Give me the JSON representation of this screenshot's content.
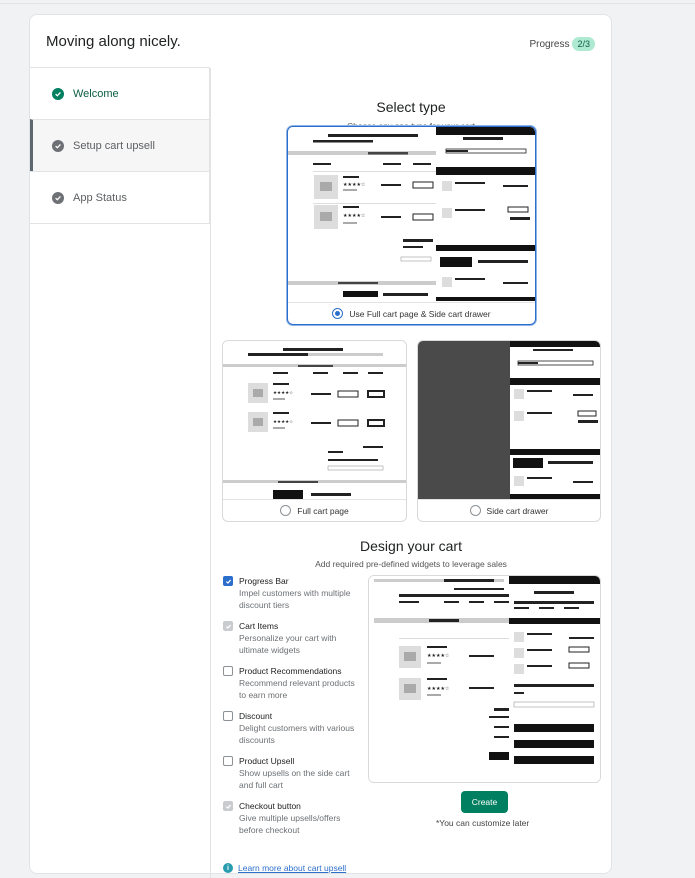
{
  "header": {
    "title": "Moving along nicely.",
    "progress_label": "Progress",
    "progress_value": "2/3"
  },
  "sidebar": {
    "items": [
      {
        "label": "Welcome",
        "status": "done"
      },
      {
        "label": "Setup cart upsell",
        "status": "todo"
      },
      {
        "label": "App Status",
        "status": "todo"
      }
    ]
  },
  "select_type": {
    "title": "Select type",
    "subtitle": "Choose any one type for your cart",
    "options": [
      {
        "label": "Use Full cart page & Side cart drawer",
        "selected": true
      },
      {
        "label": "Full cart page",
        "selected": false
      },
      {
        "label": "Side cart drawer",
        "selected": false
      }
    ]
  },
  "design": {
    "title": "Design your cart",
    "subtitle": "Add required pre-defined widgets to leverage sales",
    "widgets": [
      {
        "title": "Progress Bar",
        "desc": "Impel customers with multiple discount tiers",
        "state": "checked"
      },
      {
        "title": "Cart Items",
        "desc": "Personalize your cart with ultimate widgets",
        "state": "disabled"
      },
      {
        "title": "Product Recommendations",
        "desc": "Recommend relevant products to earn more",
        "state": "unchecked"
      },
      {
        "title": "Discount",
        "desc": "Delight customers with various discounts",
        "state": "unchecked"
      },
      {
        "title": "Product Upsell",
        "desc": "Show upsells on the side cart and full cart",
        "state": "unchecked"
      },
      {
        "title": "Checkout button",
        "desc": "Give multiple upsells/offers before checkout",
        "state": "disabled"
      }
    ],
    "create_label": "Create",
    "note": "*You can customize later"
  },
  "footer": {
    "learn_more": "Learn more about cart upsell"
  },
  "colors": {
    "accent": "#008060",
    "selected_border": "#2c6ecb",
    "badge_bg": "#aee9d1"
  }
}
